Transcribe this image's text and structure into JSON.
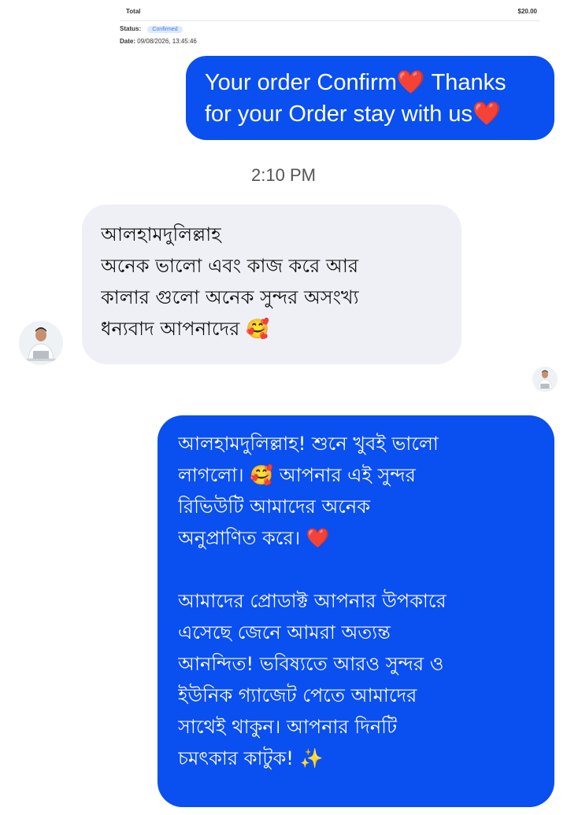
{
  "receipt": {
    "total_label": "Total",
    "total_value": "$20.00",
    "status_label": "Status:",
    "status_value": "Confirmed",
    "date_label": "Date:",
    "date_value": "09/08/2026, 13:45:46"
  },
  "conversation": {
    "timestamp": "2:10 PM",
    "messages": [
      {
        "direction": "outgoing",
        "lines": [
          "Your order Confirm❤️ Thanks",
          "for your Order stay with us❤️"
        ]
      },
      {
        "direction": "incoming",
        "lines": [
          "আলহামদুলিল্লাহ",
          "অনেক ভালো এবং কাজ করে আর",
          "কালার গুলো অনেক সুন্দর অসংখ্য",
          "ধন্যবাদ আপনাদের 🥰"
        ]
      },
      {
        "direction": "outgoing",
        "paragraphs": [
          [
            "আলহামদুলিল্লাহ! শুনে খুবই ভালো",
            "লাগলো। 🥰 আপনার এই সুন্দর",
            "রিভিউটি আমাদের অনেক",
            "অনুপ্রাণিত করে। ❤️"
          ],
          [
            "আমাদের প্রোডাক্ট আপনার উপকারে",
            "এসেছে জেনে আমরা অত্যন্ত",
            "আনন্দিত! ভবিষ্যতে আরও সুন্দর ও",
            "ইউনিক গ্যাজেট পেতে আমাদের",
            "সাথেই থাকুন। আপনার দিনটি",
            "চমৎকার কাটুক! ✨"
          ]
        ]
      }
    ]
  },
  "colors": {
    "outgoing_bubble": "#0a4ff0",
    "incoming_bubble": "#eef0f5",
    "timestamp_text": "#555555"
  }
}
